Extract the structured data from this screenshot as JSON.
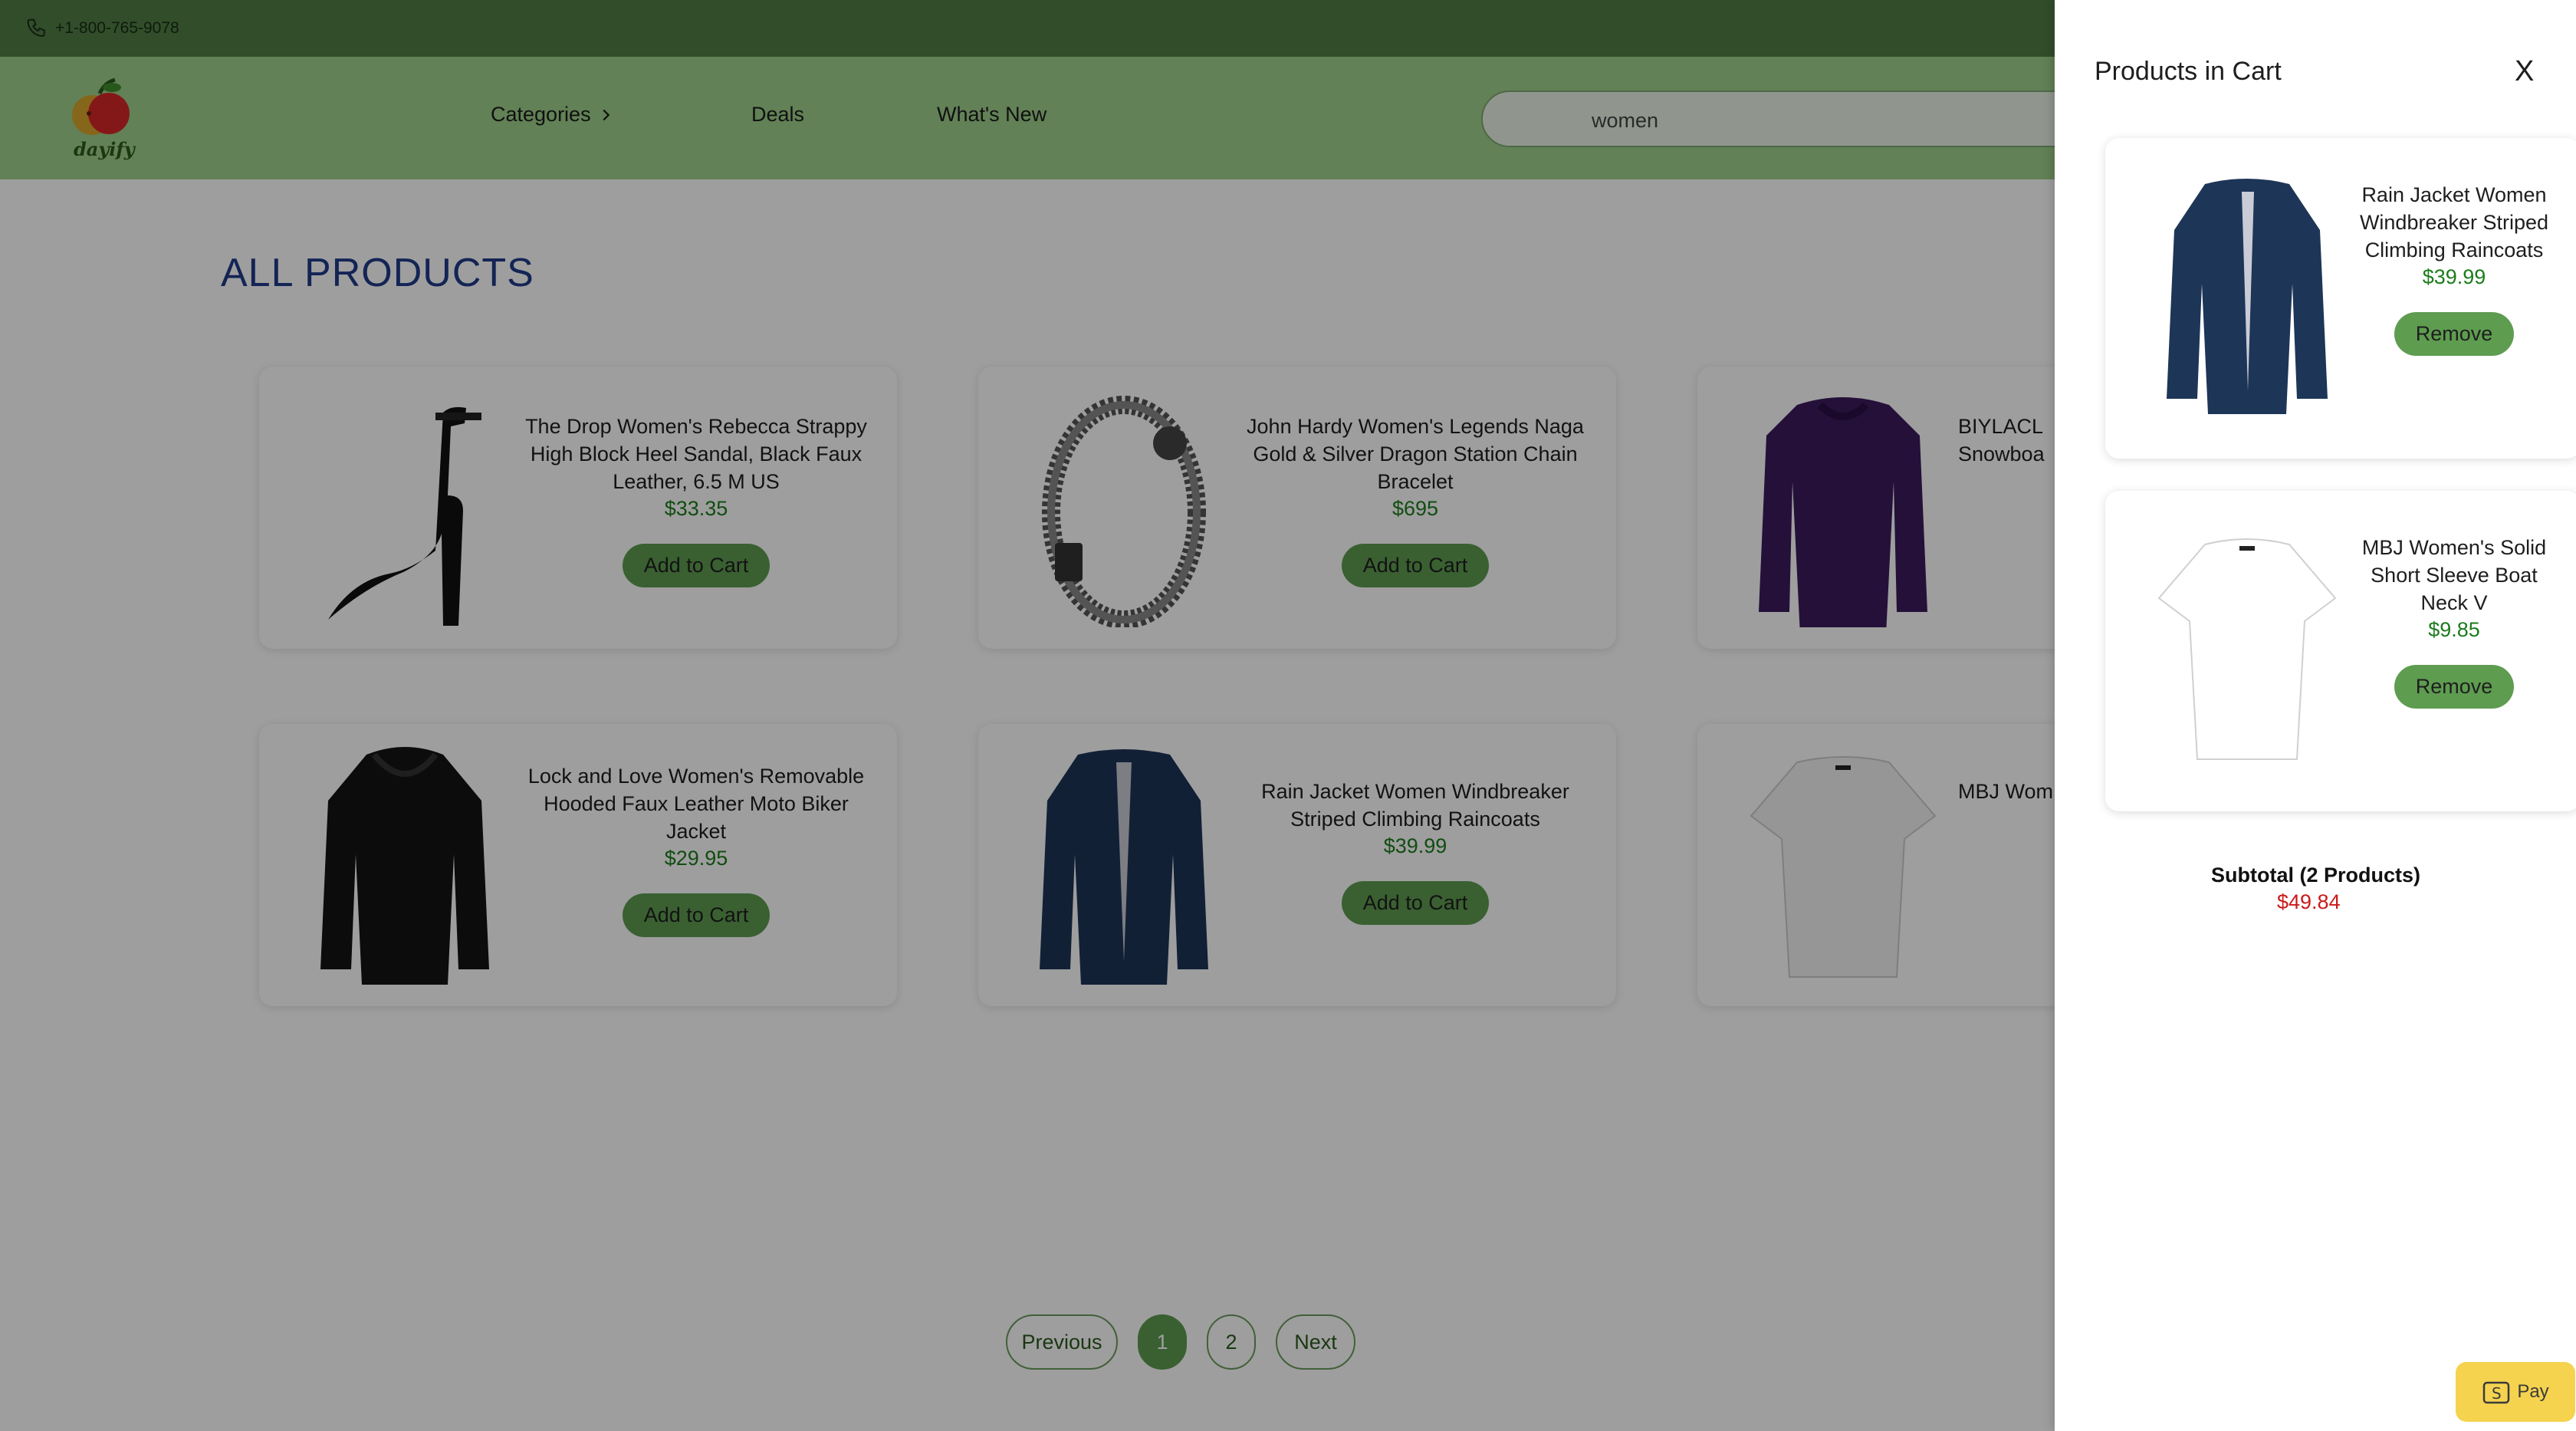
{
  "topbar": {
    "phone": "+1-800-765-9078",
    "phone_icon": "phone-icon"
  },
  "navbar": {
    "logo_text": "dayify",
    "categories": "Categories",
    "deals": "Deals",
    "whats_new": "What's New",
    "search_value": "women"
  },
  "main": {
    "title": "ALL PRODUCTS",
    "add_to_cart_label": "Add to Cart",
    "products": [
      {
        "title": "The Drop Women's Rebecca Strappy High Block Heel Sandal, Black Faux Leather, 6.5 M US",
        "price": "$33.35"
      },
      {
        "title": "John Hardy Women's Legends Naga Gold & Silver Dragon Station Chain Bracelet",
        "price": "$695"
      },
      {
        "title": "BIYLACL",
        "title2": "Snowboa",
        "price": ""
      },
      {
        "title": "Lock and Love Women's Removable Hooded Faux Leather Moto Biker Jacket",
        "price": "$29.95"
      },
      {
        "title": "Rain Jacket Women Windbreaker Striped Climbing Raincoats",
        "price": "$39.99"
      },
      {
        "title": "MBJ Wom",
        "price": ""
      }
    ]
  },
  "pagination": {
    "previous": "Previous",
    "pages": [
      "1",
      "2"
    ],
    "active_page": "1",
    "next": "Next"
  },
  "cart": {
    "title": "Products in Cart",
    "close": "X",
    "remove_label": "Remove",
    "items": [
      {
        "title": "Rain Jacket Women Windbreaker Striped Climbing Raincoats",
        "price": "$39.99"
      },
      {
        "title": "MBJ Women's Solid Short Sleeve Boat Neck V",
        "price": "$9.85"
      }
    ],
    "subtotal_label": "Subtotal (2 Products)",
    "subtotal_value": "$49.84",
    "pay_label": "Pay"
  },
  "colors": {
    "topbar": "#4f7d44",
    "navbar": "#9ed18b",
    "accent": "#5e9c50",
    "price": "#1c7c1c",
    "subtotal": "#cc1a1a",
    "pay": "#f5d34f"
  }
}
